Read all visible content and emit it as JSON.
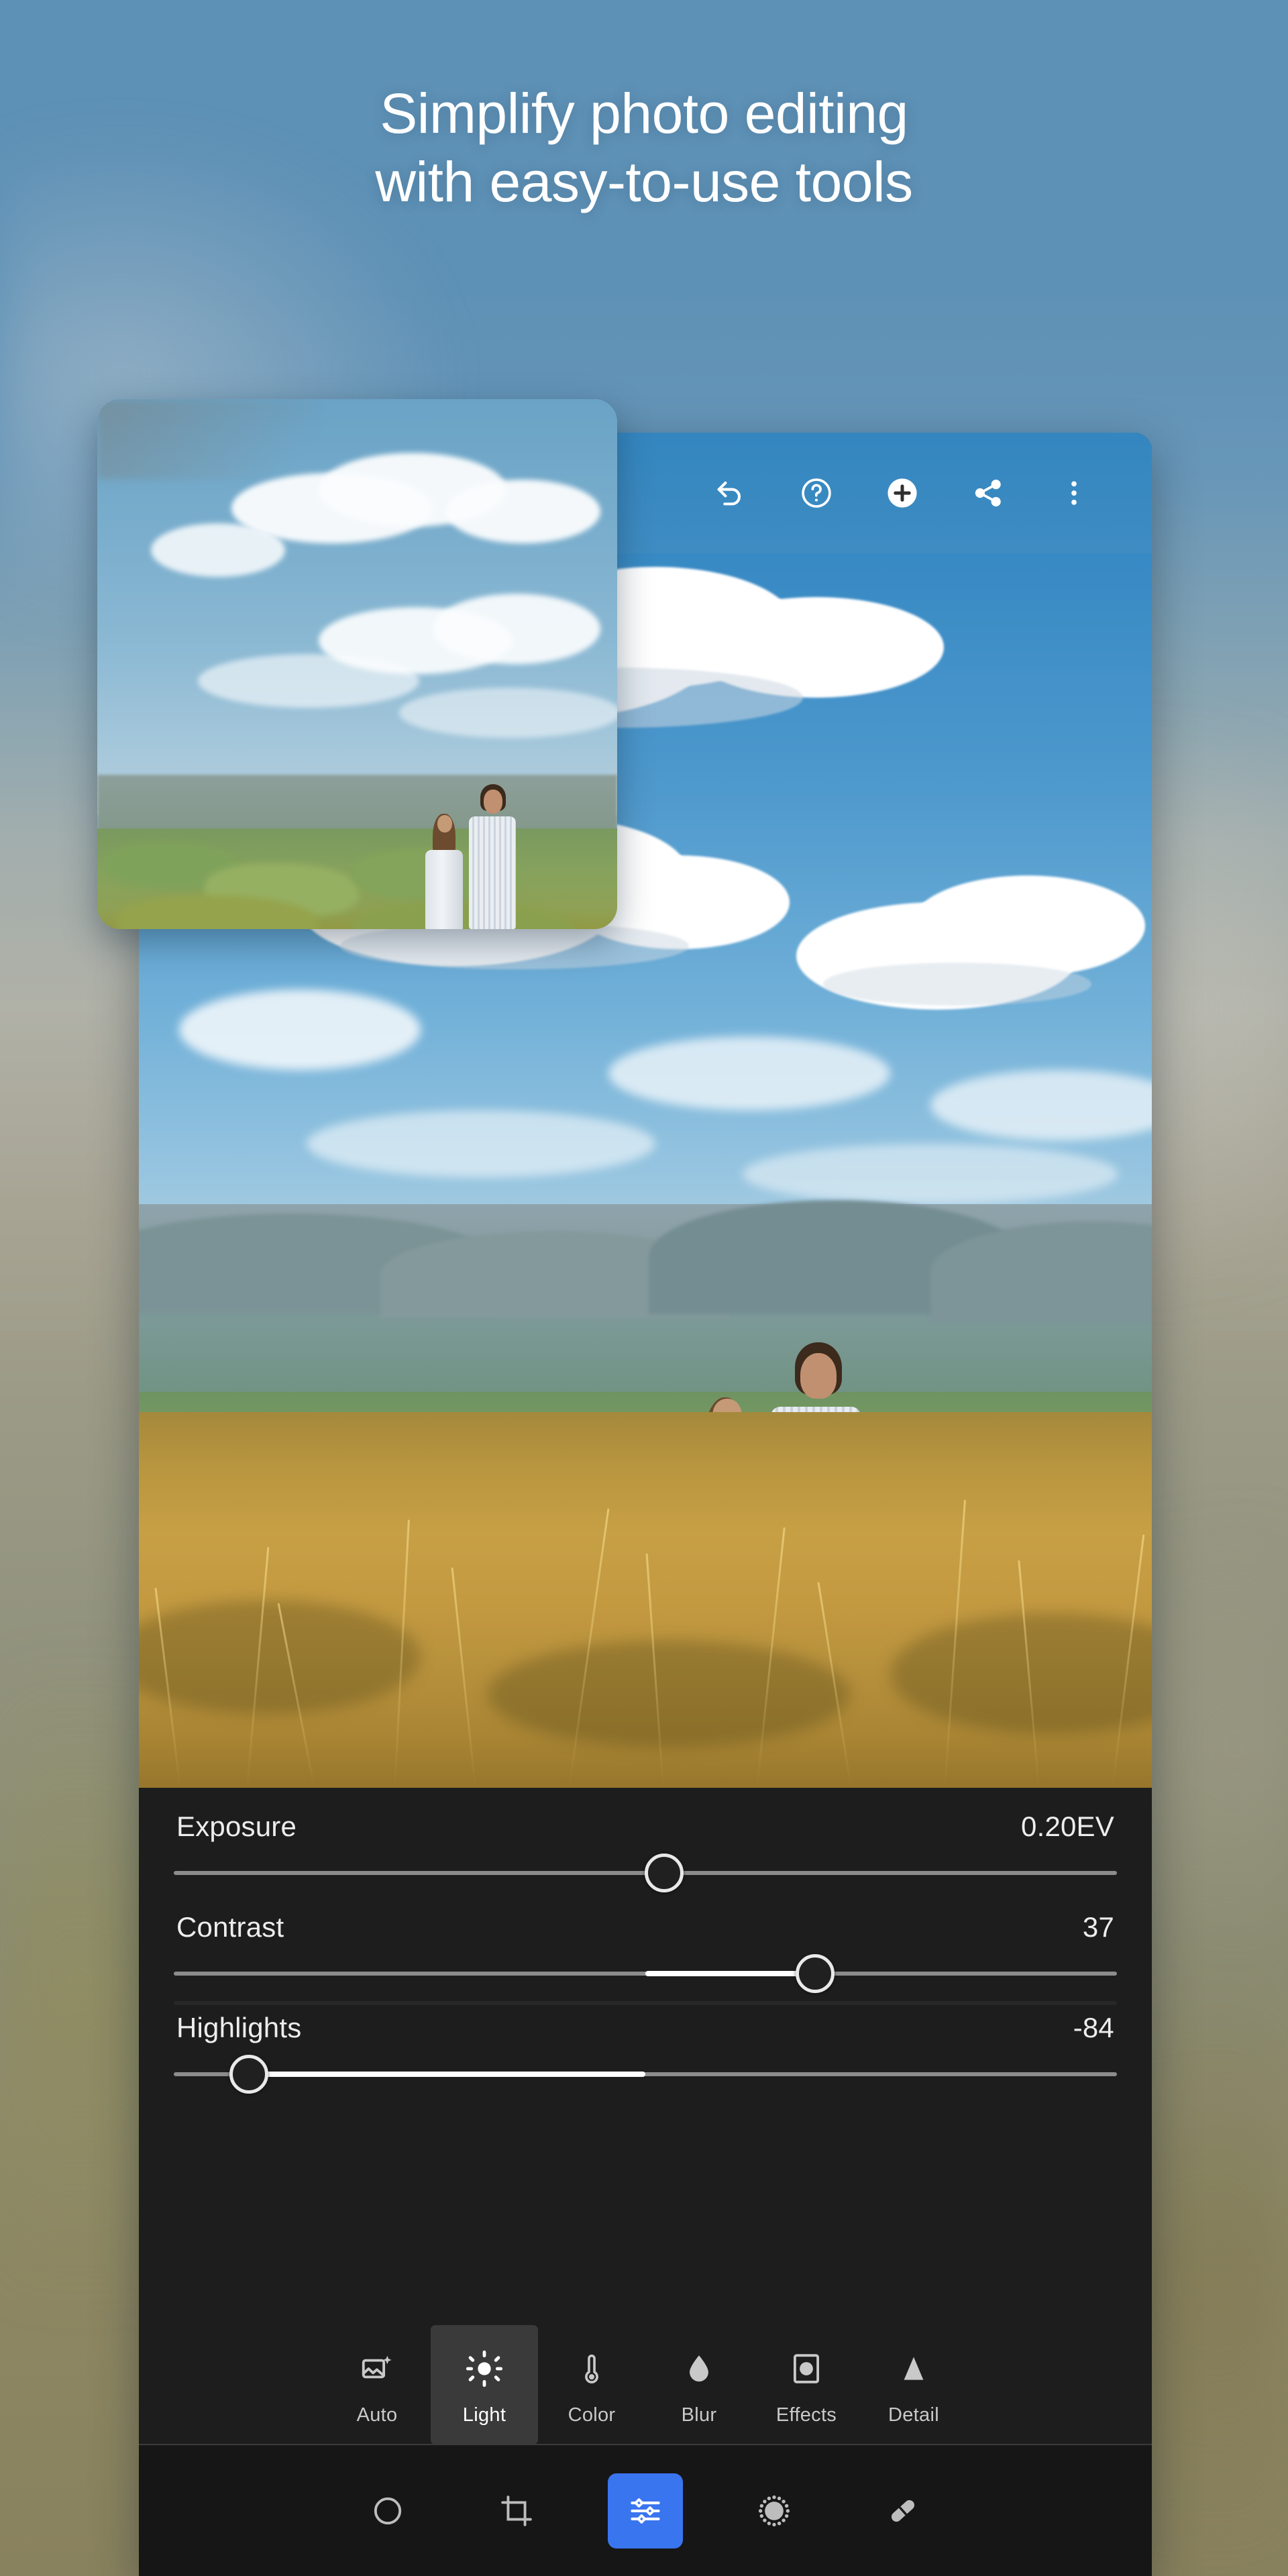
{
  "headline": {
    "line1": "Simplify photo editing",
    "line2": "with easy-to-use tools"
  },
  "colors": {
    "accent_blue": "#3a75f0",
    "appbar_blue": "#3a8cc2",
    "panel_bg": "#1d1d1d",
    "nav_bg": "#161616",
    "tab_active_bg": "#3a3a3a",
    "slider_rail": "#8c8c8c",
    "slider_fill": "#ffffff",
    "text_primary": "#ededed",
    "backdrop_top": "#5e91b6",
    "backdrop_bottom": "#89825e"
  },
  "appbar": {
    "buttons": [
      {
        "name": "undo",
        "icon": "undo-icon",
        "label": "Undo"
      },
      {
        "name": "help",
        "icon": "help-circle-icon",
        "label": "Help"
      },
      {
        "name": "add",
        "icon": "plus-circle-icon",
        "label": "Add"
      },
      {
        "name": "share",
        "icon": "share-icon",
        "label": "Share"
      },
      {
        "name": "more",
        "icon": "more-vertical-icon",
        "label": "More options"
      }
    ]
  },
  "preview_card": {
    "label": "Before preview thumbnail"
  },
  "photo": {
    "alt": "Couple standing on a golden grassy hilltop overlooking a green valley under a blue sky with clouds"
  },
  "adjustments": {
    "sliders": [
      {
        "label": "Exposure",
        "value": "0.20EV",
        "knob_pct": 52,
        "fill_from_pct": 52,
        "fill_to_pct": 52
      },
      {
        "label": "Contrast",
        "value": "37",
        "knob_pct": 68,
        "fill_from_pct": 50,
        "fill_to_pct": 68
      },
      {
        "label": "Highlights",
        "value": "-84",
        "knob_pct": 8,
        "fill_from_pct": 8,
        "fill_to_pct": 50
      }
    ]
  },
  "tool_tabs": {
    "items": [
      {
        "label": "Auto",
        "icon": "auto-enhance-icon",
        "active": false
      },
      {
        "label": "Light",
        "icon": "sun-icon",
        "active": true
      },
      {
        "label": "Color",
        "icon": "thermometer-icon",
        "active": false
      },
      {
        "label": "Blur",
        "icon": "droplet-icon",
        "active": false
      },
      {
        "label": "Effects",
        "icon": "effects-icon",
        "active": false
      },
      {
        "label": "Detail",
        "icon": "triangle-icon",
        "active": false
      }
    ]
  },
  "bottom_nav": {
    "items": [
      {
        "name": "presets",
        "icon": "presets-circle-icon",
        "label": "Presets",
        "active": false
      },
      {
        "name": "crop",
        "icon": "crop-icon",
        "label": "Crop",
        "active": false
      },
      {
        "name": "adjustments",
        "icon": "sliders-icon",
        "label": "Adjustments",
        "active": true
      },
      {
        "name": "masking",
        "icon": "dotted-circle-icon",
        "label": "Masking",
        "active": false
      },
      {
        "name": "healing",
        "icon": "healing-brush-icon",
        "label": "Healing brush",
        "active": false
      }
    ]
  }
}
